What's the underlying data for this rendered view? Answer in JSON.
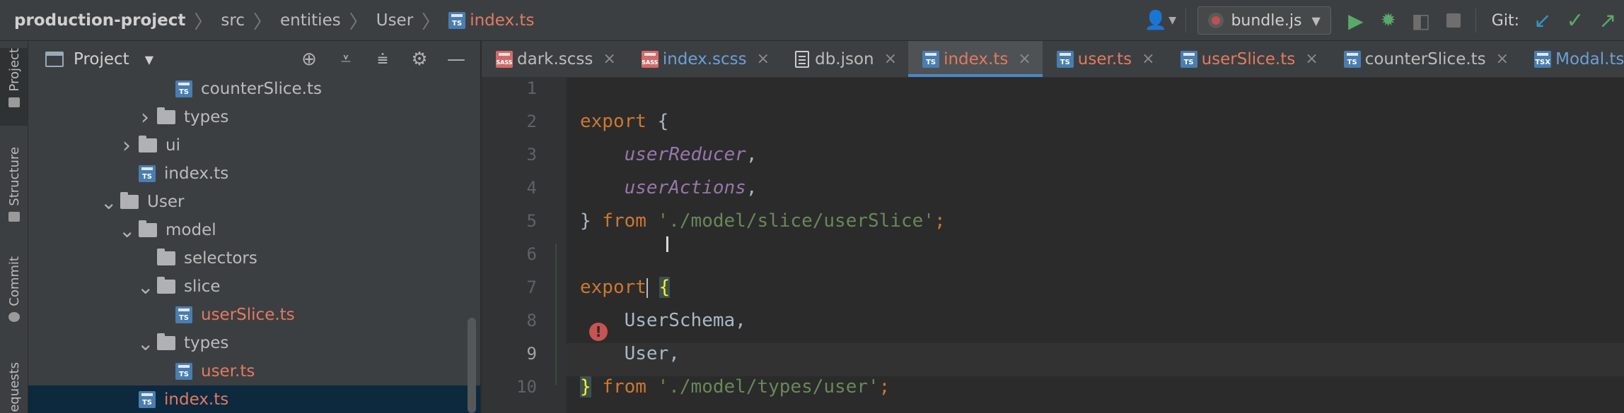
{
  "breadcrumb": {
    "project": "production-project",
    "items": [
      "src",
      "entities",
      "User"
    ],
    "file": "index.ts"
  },
  "toolbar": {
    "run_config": "bundle.js",
    "git_label": "Git:"
  },
  "tool_stripe": {
    "items": [
      "Project",
      "Structure",
      "Commit",
      "equests"
    ]
  },
  "project_panel": {
    "title": "Project",
    "tree": [
      {
        "label": "counterSlice.ts",
        "type": "ts",
        "depth": 6,
        "arrow": ""
      },
      {
        "label": "types",
        "type": "folder",
        "depth": 5,
        "arrow": "collapsed"
      },
      {
        "label": "ui",
        "type": "folder",
        "depth": 4,
        "arrow": "collapsed"
      },
      {
        "label": "index.ts",
        "type": "ts",
        "depth": 4,
        "arrow": ""
      },
      {
        "label": "User",
        "type": "folder",
        "depth": 3,
        "arrow": "expanded"
      },
      {
        "label": "model",
        "type": "folder",
        "depth": 4,
        "arrow": "expanded"
      },
      {
        "label": "selectors",
        "type": "folder",
        "depth": 5,
        "arrow": ""
      },
      {
        "label": "slice",
        "type": "folder",
        "depth": 5,
        "arrow": "expanded"
      },
      {
        "label": "userSlice.ts",
        "type": "ts",
        "depth": 6,
        "arrow": "",
        "modified": true
      },
      {
        "label": "types",
        "type": "folder",
        "depth": 5,
        "arrow": "expanded"
      },
      {
        "label": "user.ts",
        "type": "ts",
        "depth": 6,
        "arrow": "",
        "modified": true
      },
      {
        "label": "index.ts",
        "type": "ts",
        "depth": 4,
        "arrow": "",
        "modified": true,
        "selected": true
      }
    ]
  },
  "tabs": [
    {
      "label": "dark.scss",
      "icon": "sass",
      "style": "normal"
    },
    {
      "label": "index.scss",
      "icon": "sass",
      "style": "blue"
    },
    {
      "label": "db.json",
      "icon": "json",
      "style": "normal"
    },
    {
      "label": "index.ts",
      "icon": "ts",
      "style": "red",
      "active": true
    },
    {
      "label": "user.ts",
      "icon": "ts",
      "style": "red"
    },
    {
      "label": "userSlice.ts",
      "icon": "ts",
      "style": "red"
    },
    {
      "label": "counterSlice.ts",
      "icon": "ts",
      "style": "normal"
    },
    {
      "label": "Modal.tsx",
      "icon": "tsx",
      "style": "blue"
    }
  ],
  "editor": {
    "line_numbers": [
      "1",
      "2",
      "3",
      "4",
      "5",
      "6",
      "7",
      "8",
      "9",
      "10"
    ],
    "current_line": "9",
    "lines": {
      "l1": {
        "kw": "export",
        "rest": " {"
      },
      "l2": {
        "field": "userReducer",
        "rest": ","
      },
      "l3": {
        "field": "userActions",
        "rest": ","
      },
      "l4": {
        "brace": "} ",
        "kw": "from",
        "str": "'./model/slice/userSlice'",
        "end": ";"
      },
      "l6": {
        "kw": "export",
        "brace": "{"
      },
      "l7": {
        "name": "UserSchema",
        "rest": ","
      },
      "l8": {
        "name": "User",
        "rest": ","
      },
      "l9": {
        "brace": "}",
        "kw": "from",
        "str": "'./model/types/user'",
        "end": ";"
      }
    },
    "warning_icon": "!"
  }
}
